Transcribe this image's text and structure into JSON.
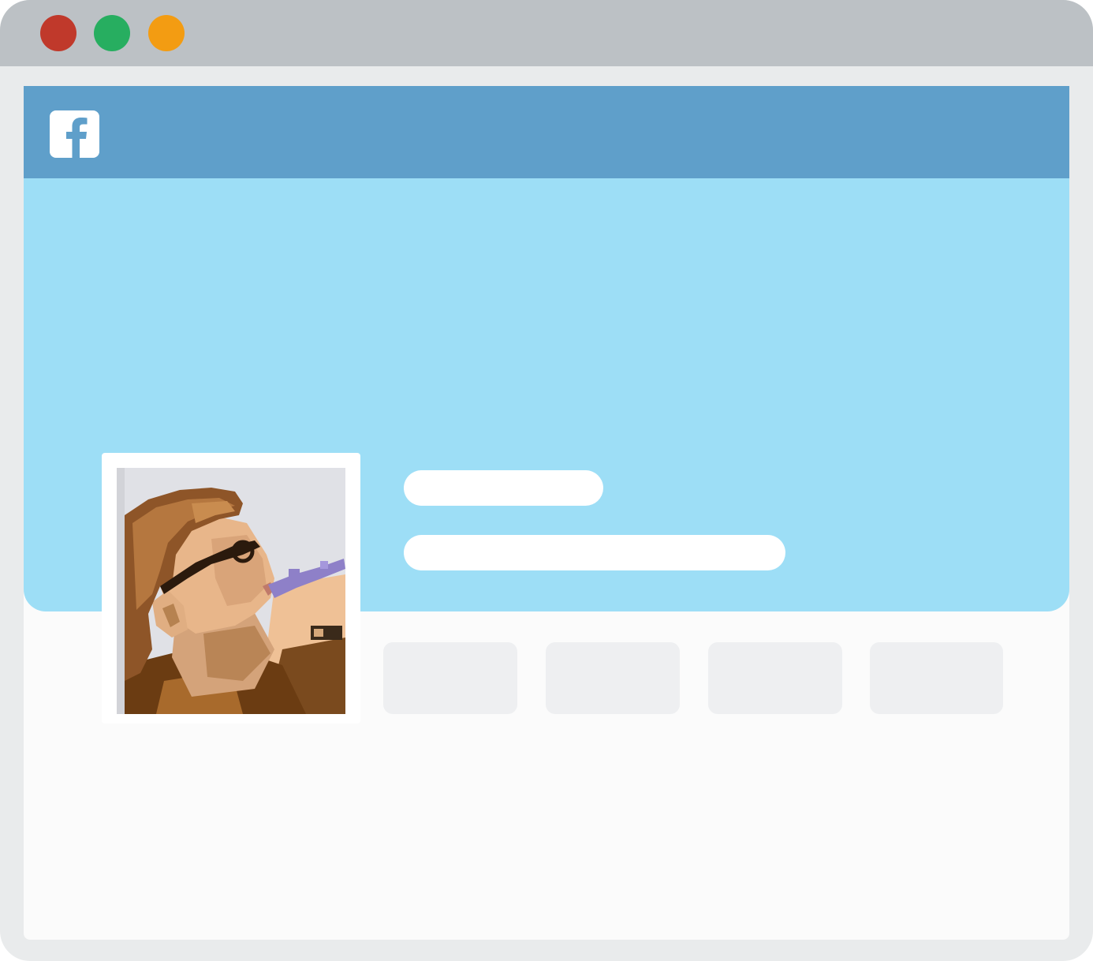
{
  "window": {
    "controls": [
      {
        "name": "close",
        "color": "#c0392b"
      },
      {
        "name": "maximize",
        "color": "#27ae60"
      },
      {
        "name": "minimize",
        "color": "#f39c12"
      }
    ]
  },
  "navbar": {
    "logo_icon": "facebook-f-icon",
    "color": "#5f9fca"
  },
  "cover": {
    "color": "#9ddef6"
  },
  "profile": {
    "photo": "profile-photo"
  },
  "tabs": [
    {
      "label": ""
    },
    {
      "label": ""
    },
    {
      "label": ""
    },
    {
      "label": ""
    }
  ]
}
